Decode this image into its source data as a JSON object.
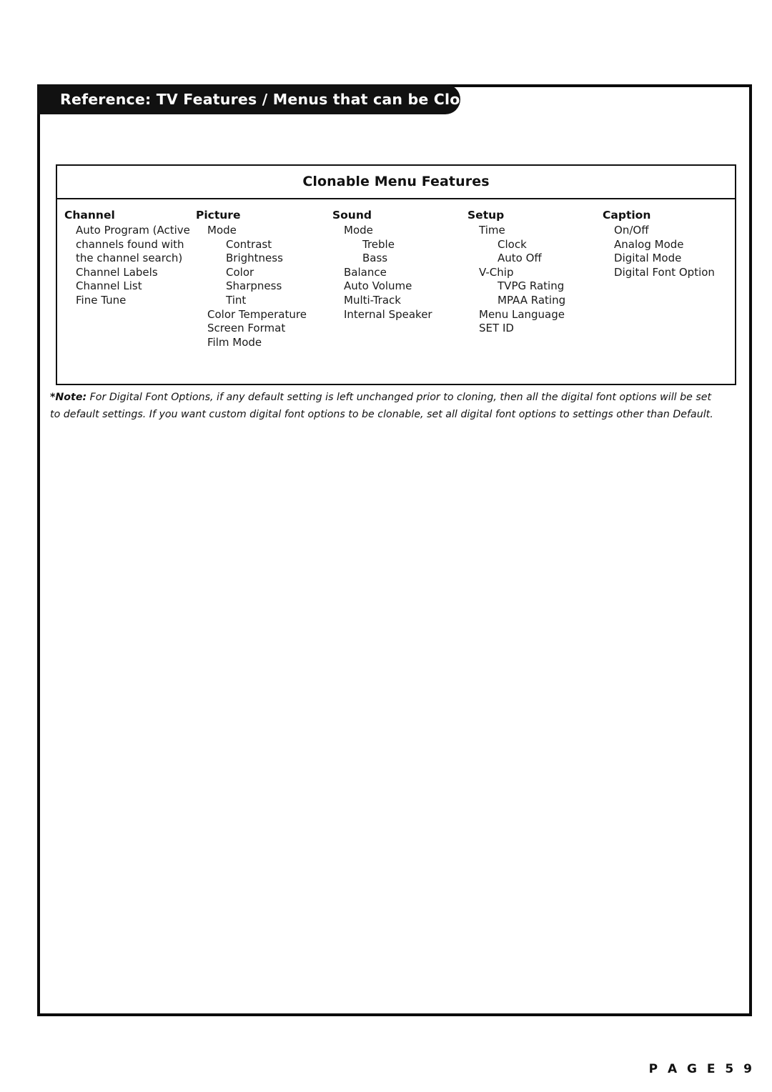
{
  "document": {
    "section_header_title": "Reference: TV Features / Menus that can be Cloned",
    "page_number_label": "P A G E  5 9"
  },
  "table": {
    "caption": "Clonable Menu Features",
    "columns": [
      {
        "header": "Channel",
        "items": [
          {
            "text": "Auto Program (Active",
            "level": 1
          },
          {
            "text": "channels found with",
            "level": 1
          },
          {
            "text": "the channel search)",
            "level": 1
          },
          {
            "text": "Channel Labels",
            "level": 1
          },
          {
            "text": "Channel List",
            "level": 1
          },
          {
            "text": "Fine Tune",
            "level": 1
          }
        ]
      },
      {
        "header": "Picture",
        "items": [
          {
            "text": "Mode",
            "level": 1
          },
          {
            "text": "Contrast",
            "level": 2
          },
          {
            "text": "Brightness",
            "level": 2
          },
          {
            "text": "Color",
            "level": 2
          },
          {
            "text": "Sharpness",
            "level": 2
          },
          {
            "text": "Tint",
            "level": 2
          },
          {
            "text": "Color Temperature",
            "level": 1
          },
          {
            "text": "Screen Format",
            "level": 1
          },
          {
            "text": "Film Mode",
            "level": 1
          }
        ]
      },
      {
        "header": "Sound",
        "items": [
          {
            "text": "Mode",
            "level": 1
          },
          {
            "text": "Treble",
            "level": 2
          },
          {
            "text": "Bass",
            "level": 2
          },
          {
            "text": "Balance",
            "level": 1
          },
          {
            "text": "Auto Volume",
            "level": 1
          },
          {
            "text": "Multi-Track",
            "level": 1
          },
          {
            "text": "Internal Speaker",
            "level": 1
          }
        ]
      },
      {
        "header": "Setup",
        "items": [
          {
            "text": "Time",
            "level": 1
          },
          {
            "text": "Clock",
            "level": 2
          },
          {
            "text": "Auto Off",
            "level": 2
          },
          {
            "text": "V-Chip",
            "level": 1
          },
          {
            "text": "TVPG Rating",
            "level": 2
          },
          {
            "text": "MPAA Rating",
            "level": 2
          },
          {
            "text": "Menu Language",
            "level": 1
          },
          {
            "text": "SET ID",
            "level": 1
          }
        ]
      },
      {
        "header": "Caption",
        "items": [
          {
            "text": "On/Off",
            "level": 1
          },
          {
            "text": "Analog Mode",
            "level": 1
          },
          {
            "text": "Digital Mode",
            "level": 1
          },
          {
            "text": "Digital Font Option",
            "level": 1
          }
        ]
      }
    ]
  },
  "note": {
    "label": "*Note:",
    "body": " For Digital Font Options, if any default setting is left unchanged prior to cloning, then all the digital font options will be set to default settings. If you want custom digital font options to be clonable, set all digital font options to settings other than Default."
  }
}
